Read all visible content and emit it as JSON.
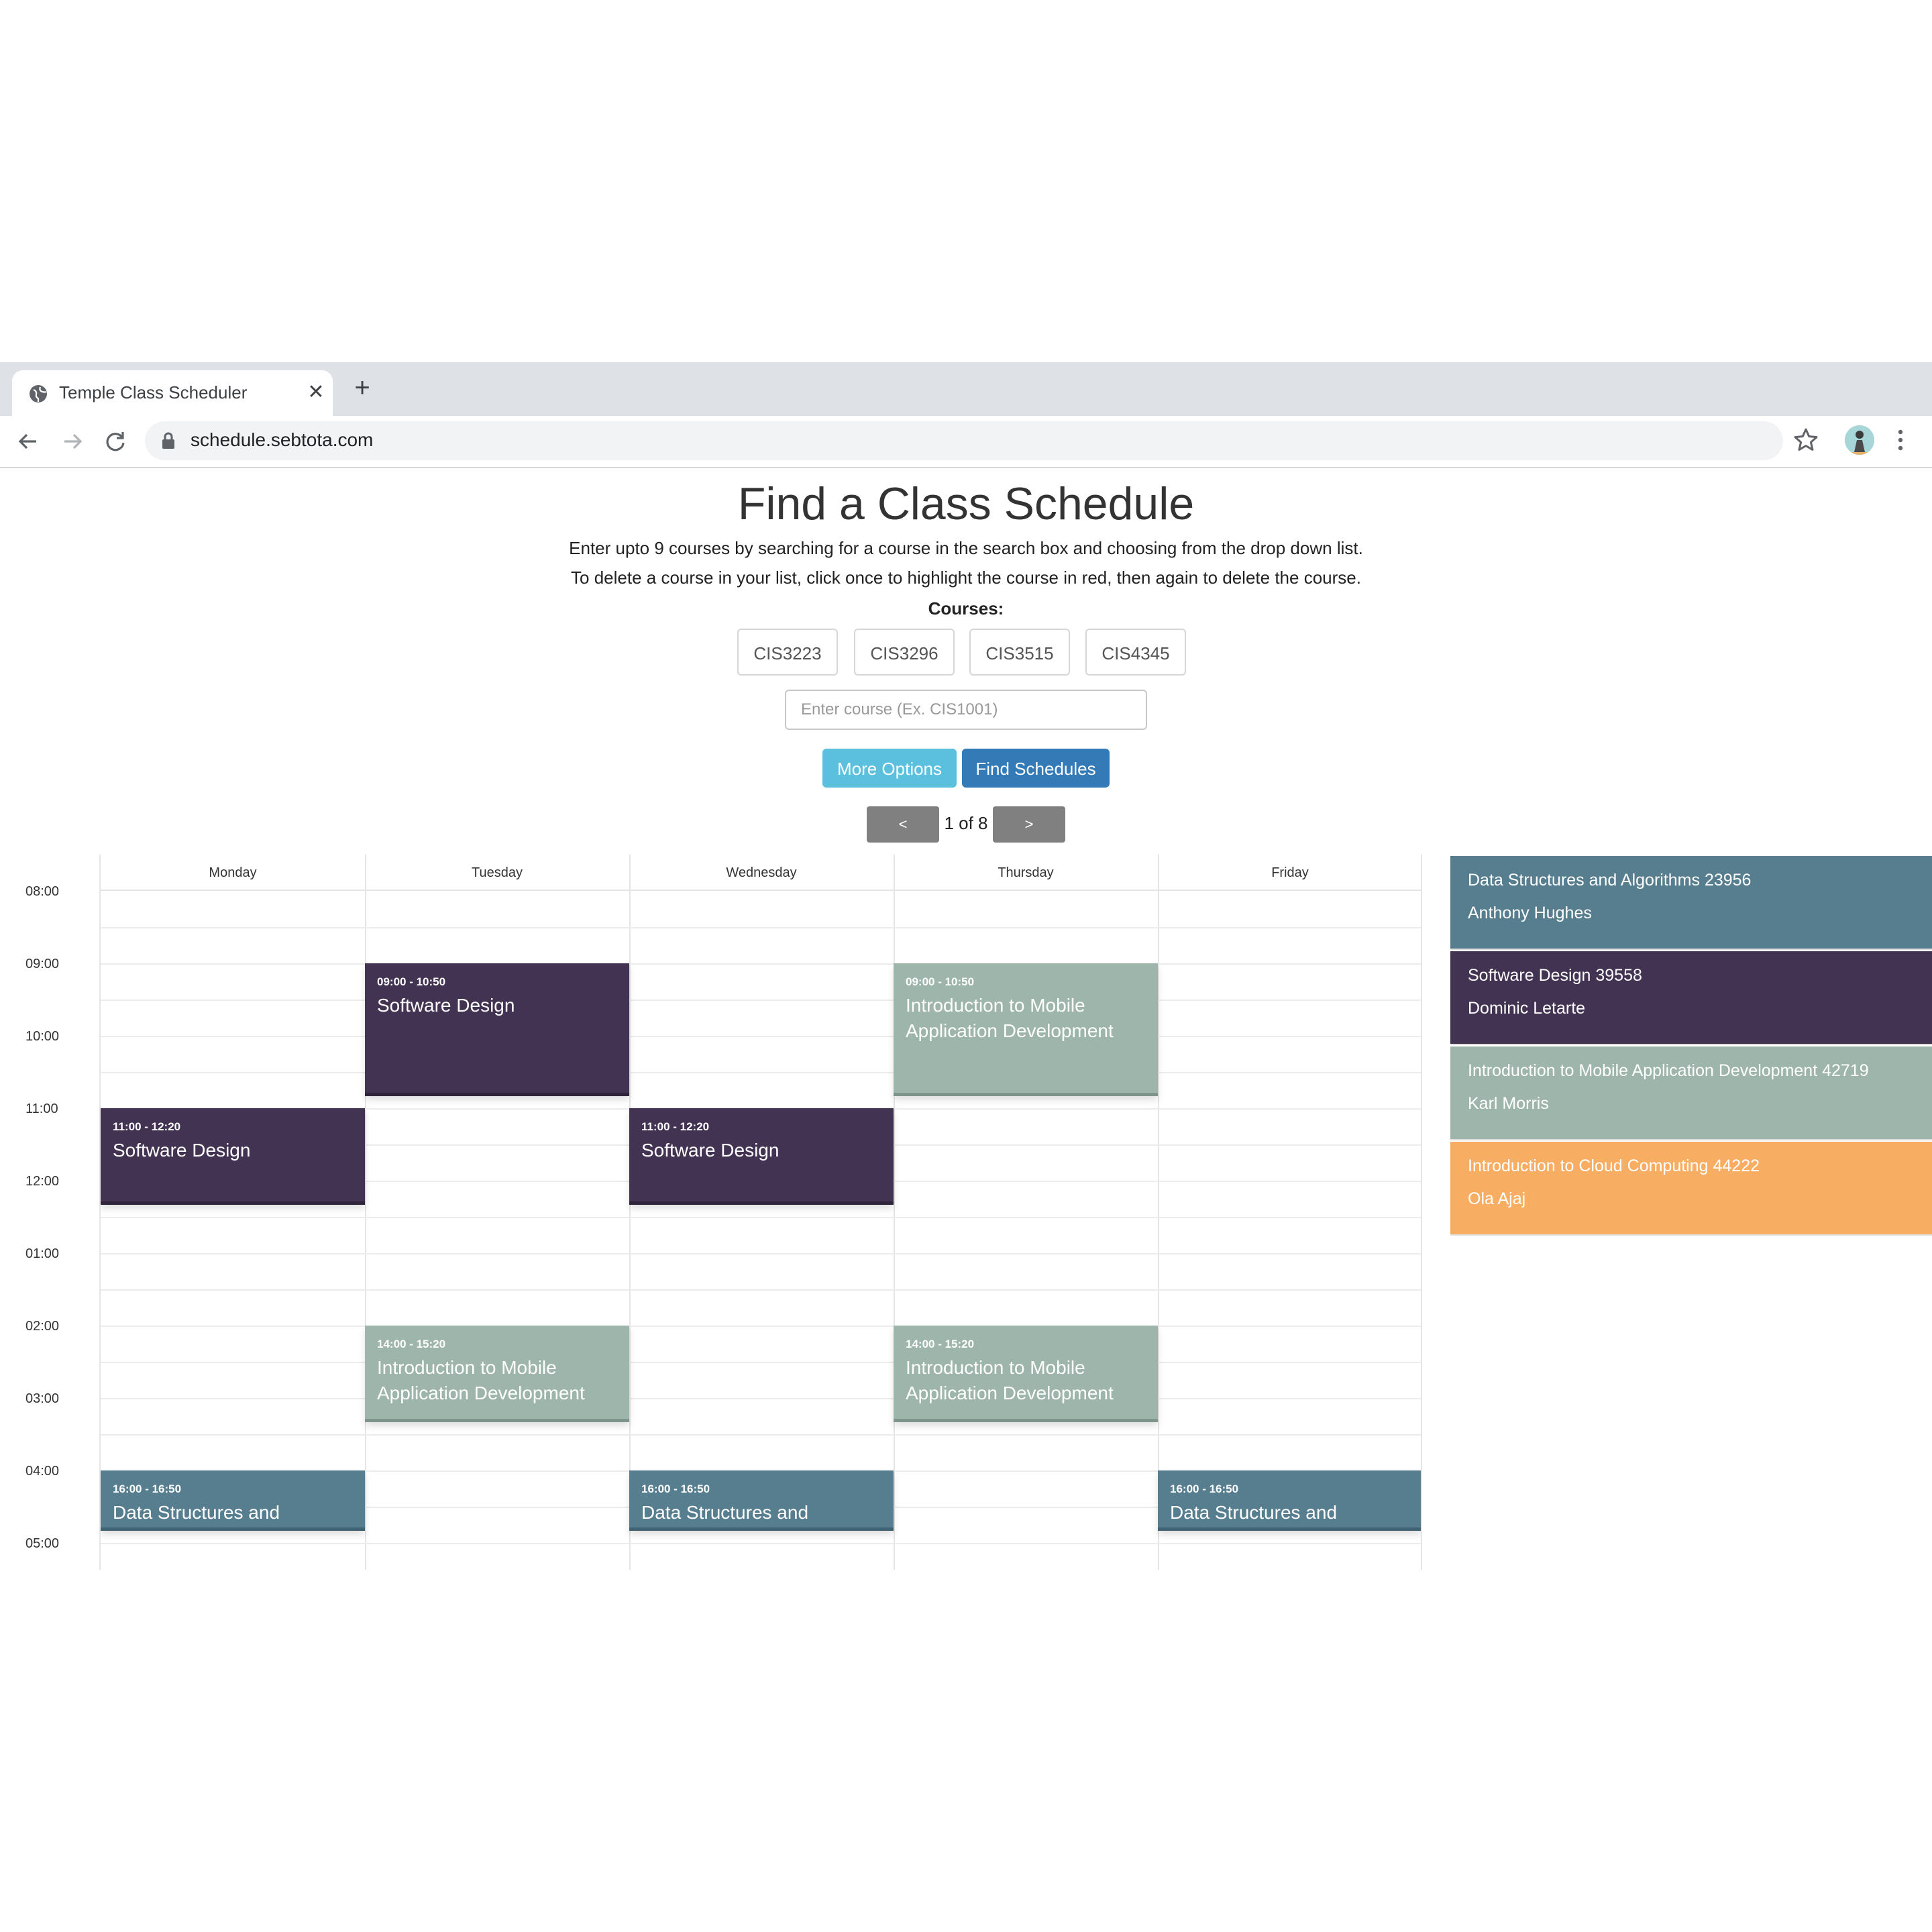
{
  "browser": {
    "tab_title": "Temple Class Scheduler",
    "url": "schedule.sebtota.com"
  },
  "page": {
    "title": "Find a Class Schedule",
    "instructions": [
      "Enter upto 9 courses by searching for a course in the search box and choosing from the drop down list.",
      "To delete a course in your list, click once to highlight the course in red, then again to delete the course."
    ],
    "courses_label": "Courses:",
    "courses": [
      "CIS3223",
      "CIS3296",
      "CIS3515",
      "CIS4345"
    ],
    "course_input_placeholder": "Enter course (Ex. CIS1001)",
    "more_options_label": "More Options",
    "find_schedules_label": "Find Schedules",
    "pager": {
      "prev": "<",
      "next": ">",
      "text": "1 of 8"
    }
  },
  "calendar": {
    "days": [
      "Monday",
      "Tuesday",
      "Wednesday",
      "Thursday",
      "Friday"
    ],
    "time_labels": [
      "08:00",
      "09:00",
      "10:00",
      "11:00",
      "12:00",
      "01:00",
      "02:00",
      "03:00",
      "04:00",
      "05:00"
    ],
    "events": [
      {
        "day": 1,
        "start": 9.0,
        "end": 10.8333,
        "time": "09:00 - 10:50",
        "title": "Software Design",
        "color": "#423352"
      },
      {
        "day": 3,
        "start": 9.0,
        "end": 10.8333,
        "time": "09:00 - 10:50",
        "title": "Introduction to Mobile Application Development",
        "color": "#9eb5ac"
      },
      {
        "day": 0,
        "start": 11.0,
        "end": 12.3333,
        "time": "11:00 - 12:20",
        "title": "Software Design",
        "color": "#423352"
      },
      {
        "day": 2,
        "start": 11.0,
        "end": 12.3333,
        "time": "11:00 - 12:20",
        "title": "Software Design",
        "color": "#423352"
      },
      {
        "day": 1,
        "start": 14.0,
        "end": 15.3333,
        "time": "14:00 - 15:20",
        "title": "Introduction to Mobile Application Development",
        "color": "#9eb5ac"
      },
      {
        "day": 3,
        "start": 14.0,
        "end": 15.3333,
        "time": "14:00 - 15:20",
        "title": "Introduction to Mobile Application Development",
        "color": "#9eb5ac"
      },
      {
        "day": 0,
        "start": 16.0,
        "end": 16.8333,
        "time": "16:00 - 16:50",
        "title": "Data Structures and",
        "color": "#577e8f"
      },
      {
        "day": 2,
        "start": 16.0,
        "end": 16.8333,
        "time": "16:00 - 16:50",
        "title": "Data Structures and",
        "color": "#577e8f"
      },
      {
        "day": 4,
        "start": 16.0,
        "end": 16.8333,
        "time": "16:00 - 16:50",
        "title": "Data Structures and",
        "color": "#577e8f"
      }
    ]
  },
  "course_list": [
    {
      "title": "Data Structures and Algorithms 23956",
      "professor": "Anthony Hughes",
      "color": "#577e8f"
    },
    {
      "title": "Software Design 39558",
      "professor": "Dominic Letarte",
      "color": "#423352"
    },
    {
      "title": "Introduction to Mobile Application Development 42719",
      "professor": "Karl Morris",
      "color": "#9eb5ac"
    },
    {
      "title": "Introduction to Cloud Computing 44222",
      "professor": "Ola Ajaj",
      "color": "#f8ae62"
    }
  ]
}
